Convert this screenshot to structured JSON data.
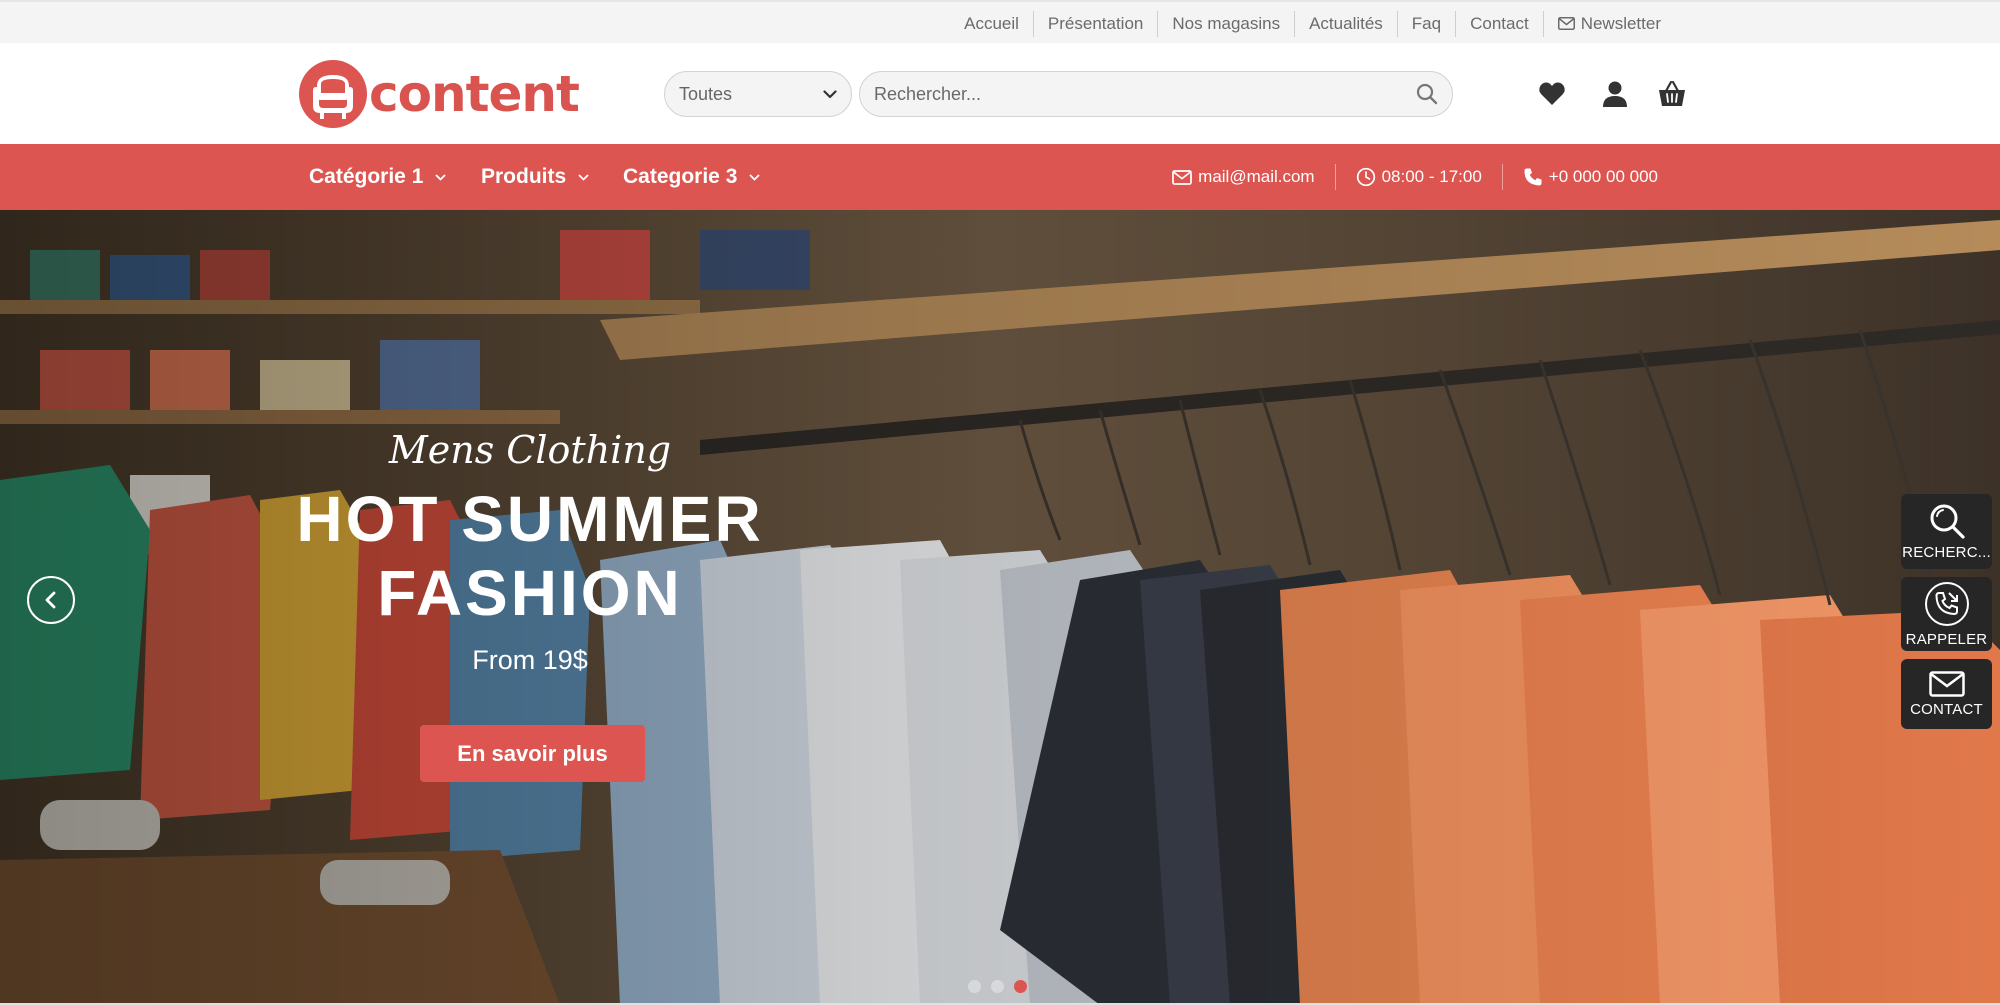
{
  "topbar": {
    "links": [
      "Accueil",
      "Présentation",
      "Nos magasins",
      "Actualités",
      "Faq",
      "Contact"
    ],
    "newsletter_label": "Newsletter"
  },
  "header": {
    "logo_text": "content",
    "category_select": "Toutes",
    "search_placeholder": "Rechercher..."
  },
  "nav": {
    "items": [
      "Catégorie 1",
      "Produits",
      "Categorie 3"
    ],
    "email": "mail@mail.com",
    "hours": "08:00 - 17:00",
    "phone": "+0 000 00 000"
  },
  "hero": {
    "subtitle": "Mens Clothing",
    "title_line1": "HOT SUMMER",
    "title_line2": "FASHION",
    "price": "From 19$",
    "button_label": "En savoir plus",
    "active_slide": 3,
    "slide_count": 3
  },
  "side_widgets": {
    "search": "RECHERC...",
    "callback": "RAPPELER",
    "contact": "CONTACT"
  },
  "colors": {
    "brand": "#dc5550",
    "topbar_bg": "#f4f4f4",
    "widget_bg": "#262626"
  }
}
